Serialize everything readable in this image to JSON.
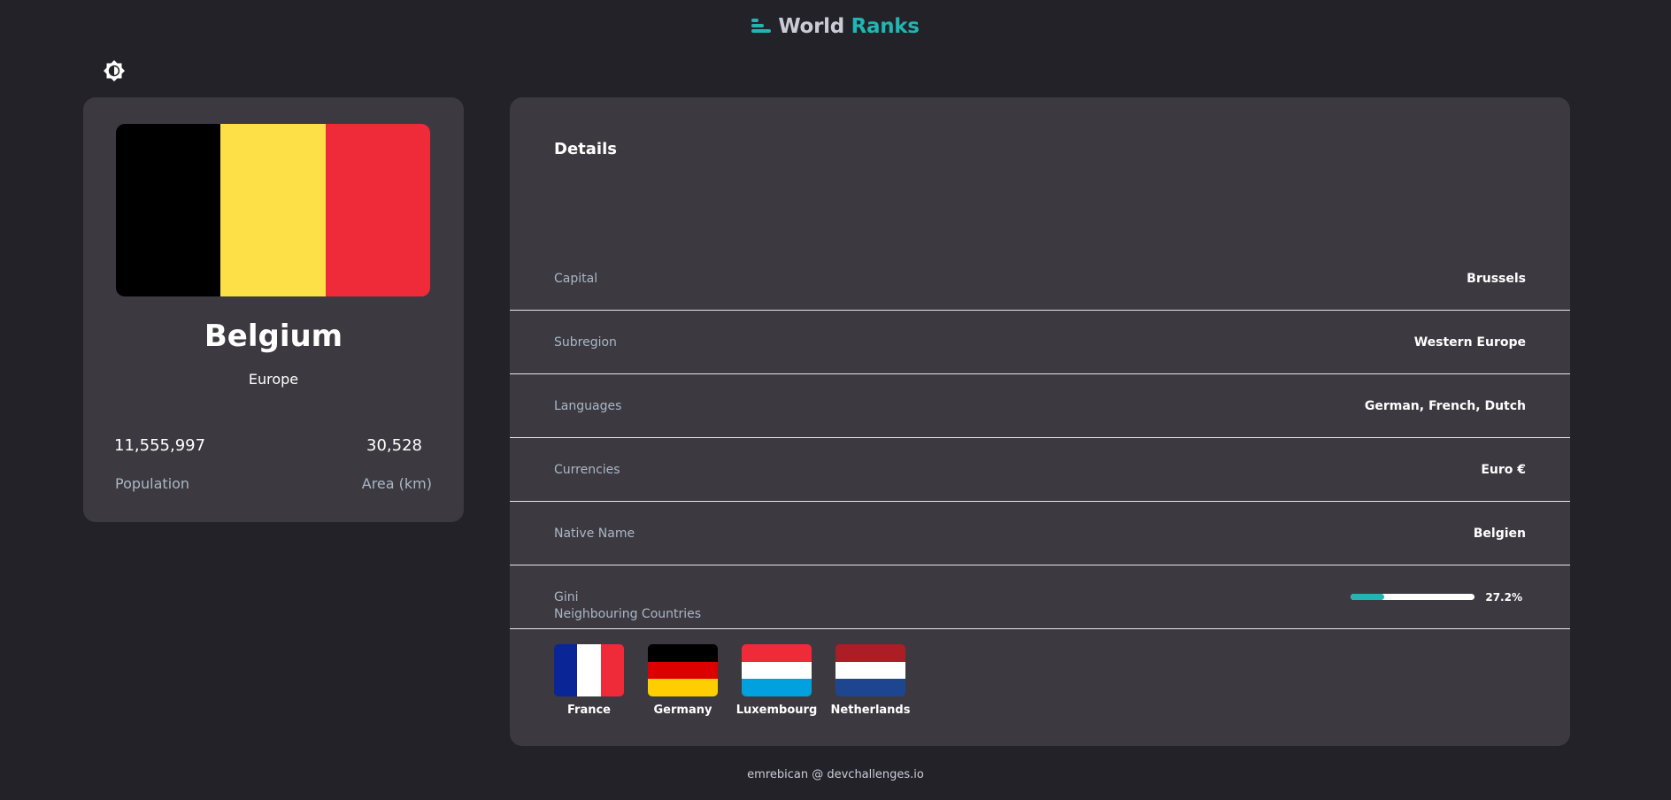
{
  "header": {
    "title_part1": "World",
    "title_part2": "Ranks",
    "logo_icon": "bars-icon",
    "accent_color": "#1fb6b3"
  },
  "theme_toggle": {
    "icon": "contrast-icon"
  },
  "country": {
    "name": "Belgium",
    "region": "Europe",
    "flag_colors": [
      "#000000",
      "#fde047",
      "#ef2b3a"
    ],
    "population": "11,555,997",
    "population_label": "Population",
    "area": "30,528",
    "area_label": "Area (km)"
  },
  "details": {
    "title": "Details",
    "rows": [
      {
        "label": "Capital",
        "value": "Brussels"
      },
      {
        "label": "Subregion",
        "value": "Western Europe"
      },
      {
        "label": "Languages",
        "value": "German, French, Dutch"
      },
      {
        "label": "Currencies",
        "value": "Euro €"
      },
      {
        "label": "Native Name",
        "value": "Belgien"
      }
    ],
    "gini": {
      "label": "Gini",
      "value_text": "27.2%",
      "fraction": 0.272
    }
  },
  "neighbours": {
    "title": "Neighbouring Countries",
    "items": [
      {
        "name": "France",
        "orientation": "v",
        "colors": [
          "#0a2596",
          "#ffffff",
          "#ef2b3a"
        ]
      },
      {
        "name": "Germany",
        "orientation": "h",
        "colors": [
          "#000000",
          "#dd0000",
          "#ffce00"
        ]
      },
      {
        "name": "Luxembourg",
        "orientation": "h",
        "colors": [
          "#ef2b3a",
          "#ffffff",
          "#00a1de"
        ]
      },
      {
        "name": "Netherlands",
        "orientation": "h",
        "colors": [
          "#ad1d25",
          "#ffffff",
          "#1e4690"
        ]
      }
    ]
  },
  "footer": {
    "text": "emrebican @ devchallenges.io"
  }
}
